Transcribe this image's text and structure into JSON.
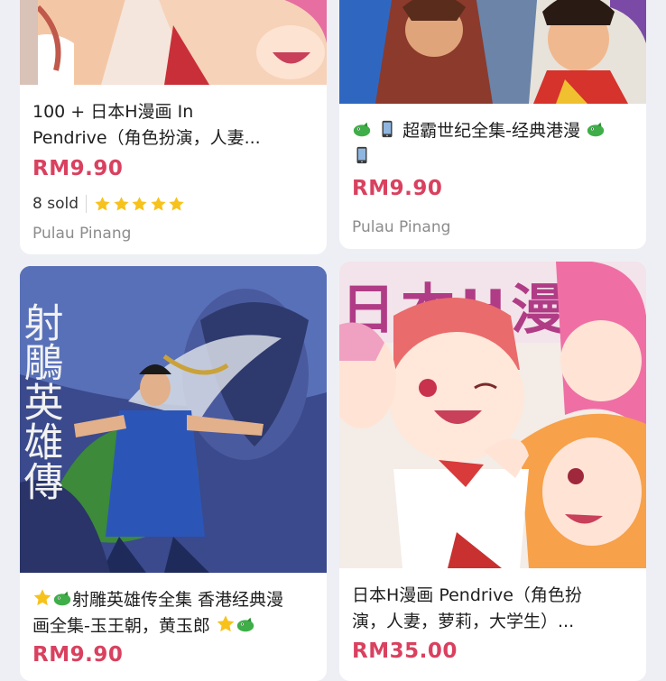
{
  "colors": {
    "page_bg": "#eeeff5",
    "price": "#d9415f",
    "star": "#f7c21c"
  },
  "products": [
    {
      "title_lines": [
        "100 + 日本H漫画 In",
        "Pendrive（角色扮演，人妻..."
      ],
      "price": "RM9.90",
      "sold": "8 sold",
      "rating": 5,
      "location": "Pulau Pinang",
      "image": "anime-girls-cover-partial"
    },
    {
      "title_pre_icons": [
        "dragon-emoji-icon",
        "phone-emoji-icon"
      ],
      "title_text": "超霸世纪全集-经典港漫",
      "title_post_icons": [
        "dragon-emoji-icon",
        "phone-emoji-icon"
      ],
      "price": "RM9.90",
      "location": "Pulau Pinang",
      "image": "hk-comic-heroes-cover"
    },
    {
      "title_line1_text": "射雕英雄传全集 香港经典漫",
      "title_line2_text": "画全集-玉王朝，黄玉郎",
      "title_icons": [
        "star-emoji-icon",
        "dragon-emoji-icon"
      ],
      "price": "RM9.90",
      "image": "condor-heroes-cover",
      "cover_calligraphy": "射鵰英雄傳"
    },
    {
      "title_lines": [
        "日本H漫画 Pendrive（角色扮",
        "演，人妻，萝莉，大学生）..."
      ],
      "price": "RM35.00",
      "image": "anime-girls-cover",
      "banner_text": "日本H漫画"
    }
  ]
}
